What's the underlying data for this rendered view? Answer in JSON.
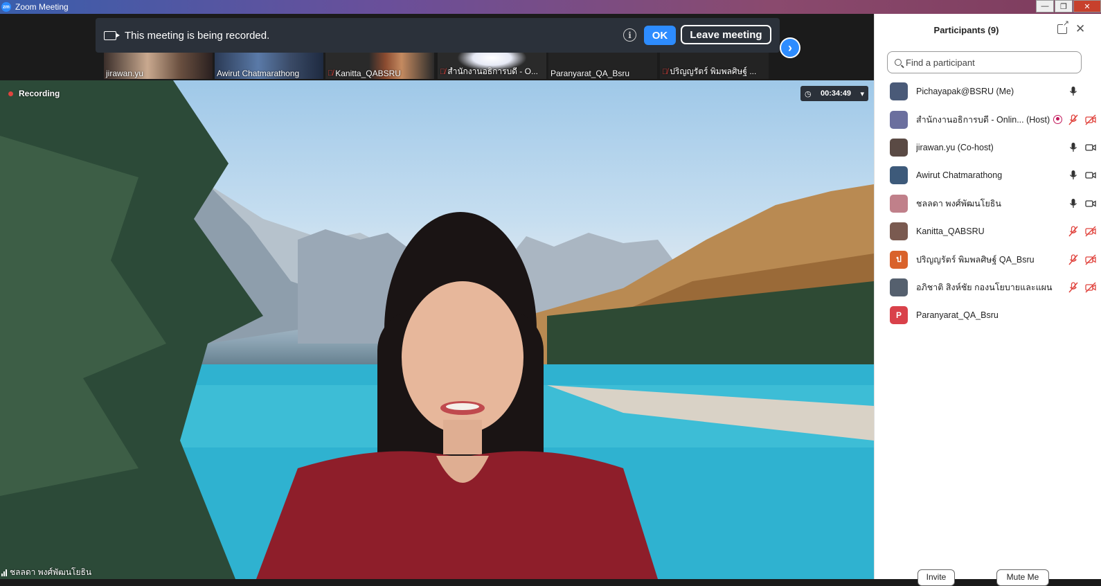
{
  "window": {
    "title": "Zoom Meeting",
    "app_icon_text": "zm"
  },
  "banner": {
    "message": "This meeting is being recorded.",
    "ok_label": "OK",
    "leave_label": "Leave meeting",
    "info_glyph": "i",
    "next_glyph": "›"
  },
  "thumbnails": [
    {
      "name": "jirawan.yu",
      "muted": false
    },
    {
      "name": "Awirut Chatmarathong",
      "muted": false
    },
    {
      "name": "Kanitta_QABSRU",
      "muted": true
    },
    {
      "name": "สำนักงานอธิการบดี - O...",
      "muted": true
    },
    {
      "name": "Paranyarat_QA_Bsru",
      "muted": false
    },
    {
      "name": "ปริญญรัตร์ พิมพลศิษฐ์ ...",
      "muted": true
    }
  ],
  "video": {
    "recording_label": "Recording",
    "timer": "00:34:49",
    "speaker_name": "ชลลดา พงศ์พัฒนโยธิน"
  },
  "participants": {
    "title": "Participants (9)",
    "search_placeholder": "Find a participant",
    "invite_label": "Invite",
    "mute_me_label": "Mute Me",
    "list": [
      {
        "name": "Pichayapak@BSRU (Me)",
        "avatar_color": "#4a5a78",
        "avatar_text": "",
        "mic": "on",
        "video": "none",
        "recording": false
      },
      {
        "name": "สำนักงานอธิการบดี - Onlin... (Host)",
        "avatar_color": "#6b6f9e",
        "avatar_text": "",
        "mic": "muted",
        "video": "off",
        "recording": true
      },
      {
        "name": "jirawan.yu (Co-host)",
        "avatar_color": "#5a4a44",
        "avatar_text": "",
        "mic": "on",
        "video": "on",
        "recording": false
      },
      {
        "name": "Awirut Chatmarathong",
        "avatar_color": "#3d5a7a",
        "avatar_text": "",
        "mic": "on",
        "video": "on",
        "recording": false
      },
      {
        "name": "ชลลดา พงศ์พัฒนโยธิน",
        "avatar_color": "#c0808a",
        "avatar_text": "",
        "mic": "on",
        "video": "on",
        "recording": false
      },
      {
        "name": "Kanitta_QABSRU",
        "avatar_color": "#7a5a50",
        "avatar_text": "",
        "mic": "muted",
        "video": "off",
        "recording": false
      },
      {
        "name": "ปริญญรัตร์ พิมพลศิษฐ์ QA_Bsru",
        "avatar_color": "#d9622b",
        "avatar_text": "ป",
        "mic": "muted",
        "video": "off",
        "recording": false
      },
      {
        "name": "อภิชาติ สิงห์ชัย กองนโยบายและแผน",
        "avatar_color": "#55606e",
        "avatar_text": "",
        "mic": "muted",
        "video": "off",
        "recording": false
      },
      {
        "name": "Paranyarat_QA_Bsru",
        "avatar_color": "#d9414a",
        "avatar_text": "P",
        "mic": "none",
        "video": "none",
        "recording": false
      }
    ]
  },
  "colors": {
    "accent": "#2d8cff",
    "muted_red": "#e0443e",
    "banner_bg": "#2b313a"
  }
}
